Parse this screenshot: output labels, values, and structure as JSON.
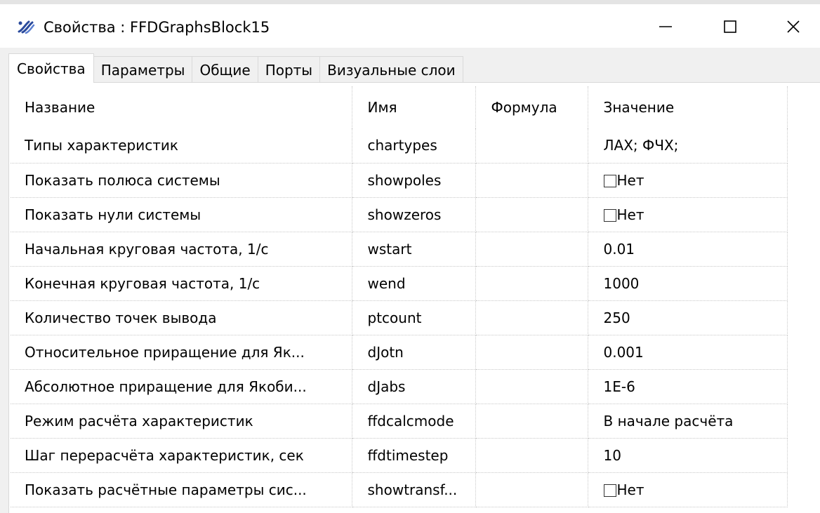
{
  "window": {
    "title_prefix": "Свойства :",
    "title_block": "FFDGraphsBlock15"
  },
  "tabs": [
    {
      "label": "Свойства",
      "active": true
    },
    {
      "label": "Параметры",
      "active": false
    },
    {
      "label": "Общие",
      "active": false
    },
    {
      "label": "Порты",
      "active": false
    },
    {
      "label": "Визуальные слои",
      "active": false
    }
  ],
  "table": {
    "headers": {
      "name": "Название",
      "id": "Имя",
      "formula": "Формула",
      "value": "Значение"
    },
    "rows": [
      {
        "name": "Типы характеристик",
        "id": "chartypes",
        "formula": "",
        "value": "ЛАХ; ФЧХ;",
        "checkbox": false
      },
      {
        "name": "Показать полюса системы",
        "id": "showpoles",
        "formula": "",
        "value": "Нет",
        "checkbox": true
      },
      {
        "name": "Показать нули системы",
        "id": "showzeros",
        "formula": "",
        "value": "Нет",
        "checkbox": true
      },
      {
        "name": "Начальная круговая частота, 1/с",
        "id": "wstart",
        "formula": "",
        "value": "0.01",
        "checkbox": false
      },
      {
        "name": "Конечная круговая частота, 1/с",
        "id": "wend",
        "formula": "",
        "value": "1000",
        "checkbox": false
      },
      {
        "name": "Количество точек вывода",
        "id": "ptcount",
        "formula": "",
        "value": "250",
        "checkbox": false
      },
      {
        "name": "Относительное приращение для Як...",
        "id": "dJotn",
        "formula": "",
        "value": "0.001",
        "checkbox": false
      },
      {
        "name": "Абсолютное приращение для Якоби...",
        "id": "dJabs",
        "formula": "",
        "value": "1E-6",
        "checkbox": false
      },
      {
        "name": "Режим расчёта характеристик",
        "id": "ffdcalcmode",
        "formula": "",
        "value": "В начале расчёта",
        "checkbox": false
      },
      {
        "name": "Шаг перерасчёта характеристик, сек",
        "id": "ffdtimestep",
        "formula": "",
        "value": "10",
        "checkbox": false
      },
      {
        "name": "Показать расчётные параметры сис...",
        "id": "showtransf...",
        "formula": "",
        "value": "Нет",
        "checkbox": true
      }
    ]
  },
  "icons": {
    "app": "app-logo-icon",
    "minimize": "minimize-icon",
    "maximize": "maximize-icon",
    "close": "close-icon"
  },
  "colors": {
    "background": "#f0f0f0",
    "panel": "#ffffff",
    "grid_line": "#c8c8c8",
    "logo_blue": "#2a4a9c"
  }
}
